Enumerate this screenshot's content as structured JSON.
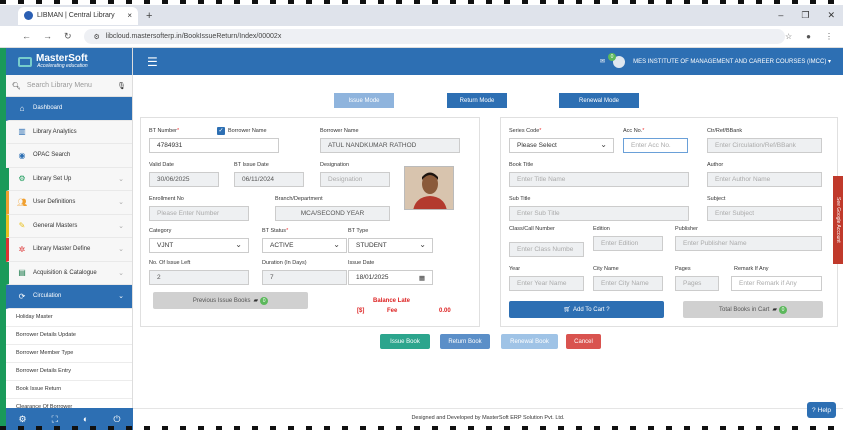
{
  "browser": {
    "tab_title": "LIBMAN | Central Library",
    "url": "libcloud.mastersofterp.in/BookIssueReturn/Index/00002x"
  },
  "brand": {
    "name": "MasterSoft",
    "tagline": "Accelerating education"
  },
  "topbar": {
    "institute": "MES INSTITUTE OF MANAGEMENT AND CAREER COURSES (IMCC) ▾",
    "notif_count": "0"
  },
  "sidebar": {
    "search_placeholder": "Search Library Menu",
    "items": [
      {
        "label": "Dashboard",
        "icon": "home-icon"
      },
      {
        "label": "Library Analytics",
        "icon": "chart-icon"
      },
      {
        "label": "OPAC Search",
        "icon": "search-icon"
      },
      {
        "label": "Library Set Up",
        "icon": "gears-icon"
      },
      {
        "label": "User Definitions",
        "icon": "users-icon"
      },
      {
        "label": "General Masters",
        "icon": "edit-icon"
      },
      {
        "label": "Library Master Define",
        "icon": "cog-icon"
      },
      {
        "label": "Acquisition & Catalogue",
        "icon": "book-icon"
      },
      {
        "label": "Circulation",
        "icon": "refresh-icon"
      }
    ],
    "sub_items": [
      "Holiday Master",
      "Borrower Details Update",
      "Borrower Member Type",
      "Borrower Details Entry",
      "Book Issue Return",
      "Clearance Of Borrower"
    ]
  },
  "modes": {
    "issue": "Issue Mode",
    "return": "Return Mode",
    "renewal": "Renewal Mode"
  },
  "borrower": {
    "bt_number_label": "BT Number",
    "bt_number": "4784931",
    "borrower_name_chk": "Borrower Name",
    "borrower_name_label": "Borrower Name",
    "borrower_name": "ATUL NANDKUMAR RATHOD",
    "valid_date_label": "Valid Date",
    "valid_date": "30/06/2025",
    "bt_issue_date_label": "BT Issue Date",
    "bt_issue_date": "06/11/2024",
    "designation_label": "Designation",
    "designation_ph": "Designation",
    "enrollment_label": "Enrollment No",
    "enrollment_ph": "Please Enter Number",
    "branch_label": "Branch/Department",
    "branch": "MCA/SECOND YEAR",
    "category_label": "Category",
    "category": "VJNT",
    "bt_status_label": "BT Status",
    "bt_status": "ACTIVE",
    "bt_type_label": "BT Type",
    "bt_type": "STUDENT",
    "issue_left_label": "No. Of Issue Left",
    "issue_left": "2",
    "duration_label": "Duration (In Days)",
    "duration": "7",
    "issue_date_label": "Issue Date",
    "issue_date": "18/01/2025",
    "prev_books": "Previous Issue Books",
    "prev_books_count": "0",
    "balance_label": "Balance Late",
    "fee_label": "Fee",
    "fee_value": "0.00"
  },
  "book": {
    "series_label": "Series Code",
    "series": "Please Select",
    "acc_label": "Acc No.",
    "acc_ph": "Enter Acc No.",
    "ctr_label": "Ctr/Ref/BBank",
    "ctr_ph": "Enter Circulation/Ref/BBank",
    "title_label": "Book Title",
    "title_ph": "Enter Title Name",
    "author_label": "Author",
    "author_ph": "Enter Author Name",
    "subtitle_label": "Sub Title",
    "subtitle_ph": "Enter Sub Title",
    "subject_label": "Subject",
    "subject_ph": "Enter Subject",
    "class_label": "Class/Call Number",
    "class_ph": "Enter Class Numbe",
    "edition_label": "Edition",
    "edition_ph": "Enter Edition",
    "publisher_label": "Publisher",
    "publisher_ph": "Enter Publisher Name",
    "year_label": "Year",
    "year_ph": "Enter Year Name",
    "city_label": "City Name",
    "city_ph": "Enter City Name",
    "pages_label": "Pages",
    "pages_ph": "Pages",
    "remark_label": "Remark If Any",
    "remark_ph": "Enter Remark if Any",
    "add_cart": "Add To Cart ?",
    "total_cart": "Total Books in Cart",
    "cart_count": "0"
  },
  "actions": {
    "issue": "Issue Book",
    "return": "Return Book",
    "renewal": "Renewal Book",
    "cancel": "Cancel"
  },
  "footer": "Designed and Developed by MasterSoft ERP Solution Pvt. Ltd.",
  "help": "Help",
  "side_tab": "See Google Account",
  "colors": {
    "primary": "#2d6fb3",
    "teal": "#2ca58d",
    "danger": "#d9534f",
    "mode_inactive": "#8fb4dd"
  }
}
